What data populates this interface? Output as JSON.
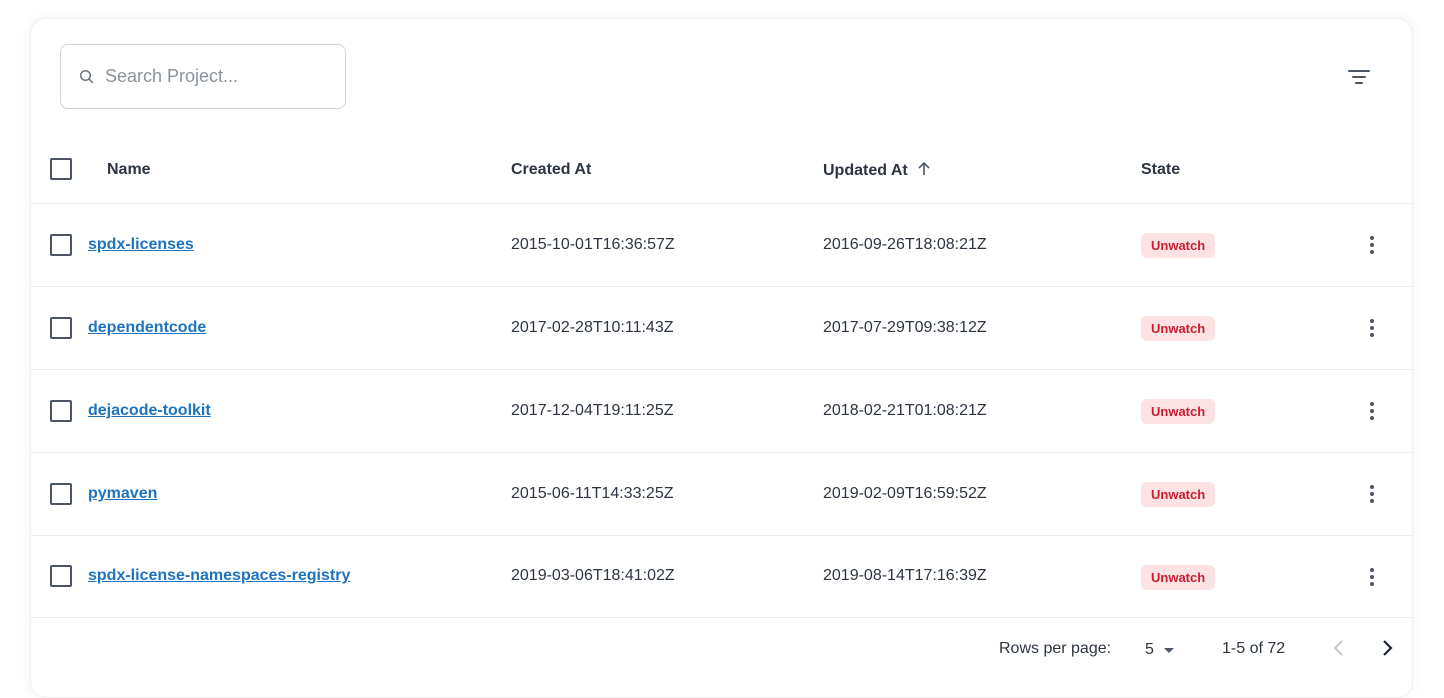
{
  "search": {
    "placeholder": "Search Project..."
  },
  "table": {
    "headers": {
      "name": "Name",
      "created_at": "Created At",
      "updated_at": "Updated At",
      "state": "State"
    },
    "sort": {
      "column": "updated_at",
      "direction": "ascending"
    },
    "rows": [
      {
        "name": "spdx-licenses",
        "created_at": "2015-10-01T16:36:57Z",
        "updated_at": "2016-09-26T18:08:21Z",
        "state": "Unwatch"
      },
      {
        "name": "dependentcode",
        "created_at": "2017-02-28T10:11:43Z",
        "updated_at": "2017-07-29T09:38:12Z",
        "state": "Unwatch"
      },
      {
        "name": "dejacode-toolkit",
        "created_at": "2017-12-04T19:11:25Z",
        "updated_at": "2018-02-21T01:08:21Z",
        "state": "Unwatch"
      },
      {
        "name": "pymaven",
        "created_at": "2015-06-11T14:33:25Z",
        "updated_at": "2019-02-09T16:59:52Z",
        "state": "Unwatch"
      },
      {
        "name": "spdx-license-namespaces-registry",
        "created_at": "2019-03-06T18:41:02Z",
        "updated_at": "2019-08-14T17:16:39Z",
        "state": "Unwatch"
      }
    ]
  },
  "pagination": {
    "rows_per_page_label": "Rows per page:",
    "rows_per_page": "5",
    "range": "1-5 of 72"
  },
  "colors": {
    "link": "#1e73be",
    "badge_text": "#c81e2f",
    "badge_bg": "#fde2e4"
  },
  "icons": [
    "search-icon",
    "filter-icon",
    "sort-arrow-up-icon",
    "more-vert-icon",
    "caret-down-icon",
    "chevron-left-icon",
    "chevron-right-icon"
  ]
}
